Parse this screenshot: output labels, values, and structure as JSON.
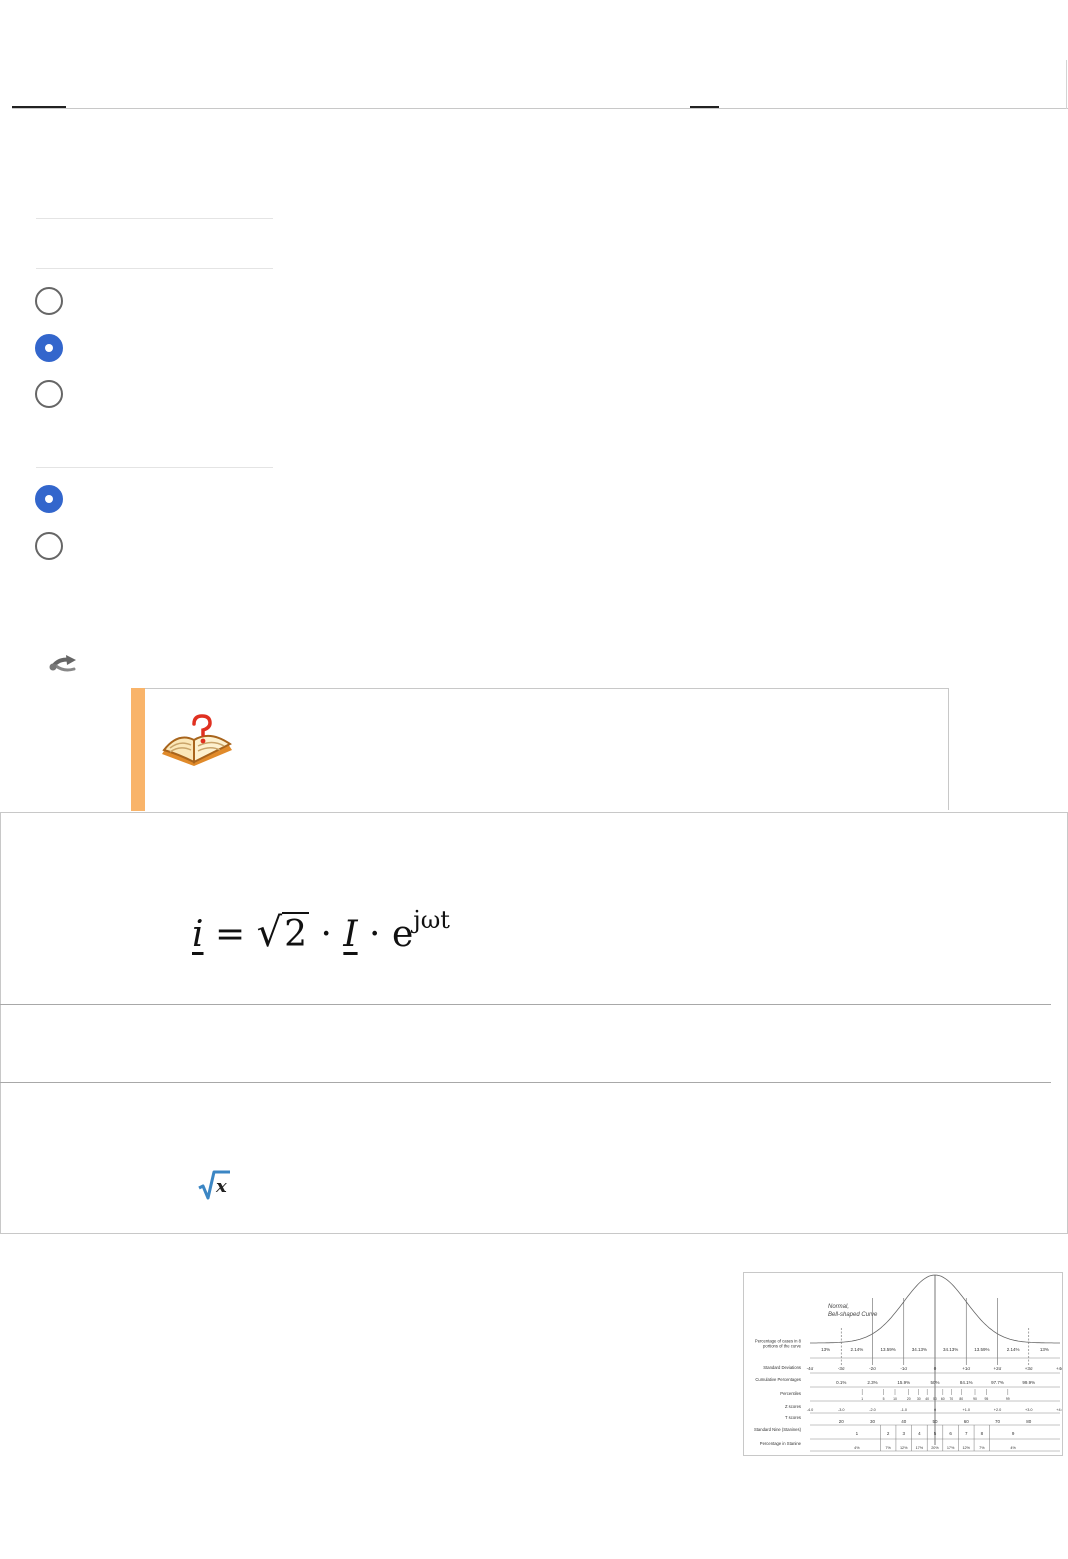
{
  "tabs": [
    {
      "id": "tab-1",
      "active": true
    },
    {
      "id": "tab-2",
      "active": false
    }
  ],
  "options": {
    "group1": [
      {
        "checked": false
      },
      {
        "checked": true
      },
      {
        "checked": false
      }
    ],
    "group2": [
      {
        "checked": true
      },
      {
        "checked": false
      }
    ]
  },
  "icons": {
    "share": "share-icon",
    "help": "book-question-icon",
    "sqrt": "sqrt-x-icon"
  },
  "formula": {
    "lhs": "i",
    "eq": "=",
    "radicand": "2",
    "dot1": "·",
    "var": "I",
    "dot2": "·",
    "base": "e",
    "exp": "jωt"
  },
  "figure": {
    "heading_line1": "Normal,",
    "heading_line2": "Bell-shaped Curve",
    "row_labels": [
      "Percentage of cases in 8 portions of the curve",
      "Standard Deviations",
      "Cumulative Percentages",
      "Percentiles",
      "Z scores",
      "T scores",
      "Standard Nine (Stanines)",
      "Percentage in Stanine"
    ],
    "percentages": [
      "13%",
      "2.14%",
      "13.59%",
      "34.13%",
      "34.13%",
      "13.59%",
      "2.14%",
      "13%"
    ],
    "std_devs": [
      "-4σ",
      "-3σ",
      "-2σ",
      "-1σ",
      "0",
      "+1σ",
      "+2σ",
      "+3σ",
      "+4σ"
    ],
    "cumulative": [
      "0.1%",
      "2.3%",
      "15.9%",
      "50%",
      "84.1%",
      "97.7%",
      "99.9%"
    ],
    "z_scores": [
      "-4.0",
      "-3.0",
      "-2.0",
      "-1.0",
      "0",
      "+1.0",
      "+2.0",
      "+3.0",
      "+4.0"
    ],
    "t_scores": [
      "20",
      "30",
      "40",
      "50",
      "60",
      "70",
      "80"
    ],
    "stanines": [
      "1",
      "2",
      "3",
      "4",
      "5",
      "6",
      "7",
      "8",
      "9"
    ],
    "stanine_pct": [
      "4%",
      "7%",
      "12%",
      "17%",
      "20%",
      "17%",
      "12%",
      "7%",
      "4%"
    ]
  },
  "colors": {
    "accent": "#3366cc",
    "help_bar": "#f9b46a",
    "tab_indicator": "#222222"
  }
}
